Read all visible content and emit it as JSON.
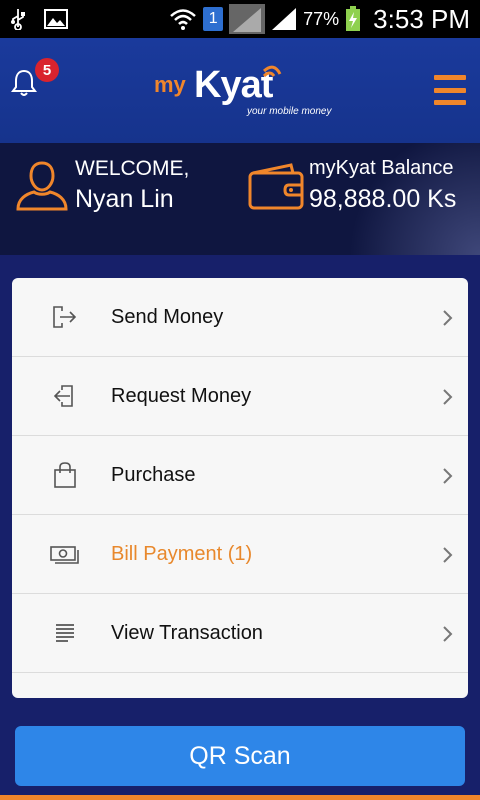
{
  "status_bar": {
    "sim_slot": "1",
    "battery_percent": "77%",
    "time": "3:53 PM"
  },
  "header": {
    "notification_count": "5",
    "logo_prefix": "my",
    "logo_main": "Kyat",
    "logo_tagline": "your mobile money"
  },
  "summary": {
    "welcome_label": "WELCOME,",
    "user_name": "Nyan Lin",
    "balance_label": "myKyat Balance",
    "balance_value": "98,888.00 Ks"
  },
  "menu": {
    "items": [
      {
        "label": "Send Money",
        "icon": "send-money-icon"
      },
      {
        "label": "Request Money",
        "icon": "request-money-icon"
      },
      {
        "label": "Purchase",
        "icon": "shopping-bag-icon"
      },
      {
        "label": "Bill Payment  (1)",
        "icon": "cash-icon"
      },
      {
        "label": "View Transaction",
        "icon": "list-icon"
      }
    ]
  },
  "qr_button": {
    "label": "QR Scan"
  },
  "colors": {
    "accent_orange": "#f0862b",
    "header_blue": "#1a3a9c",
    "button_blue": "#2e86e8",
    "badge_red": "#d9232d"
  }
}
